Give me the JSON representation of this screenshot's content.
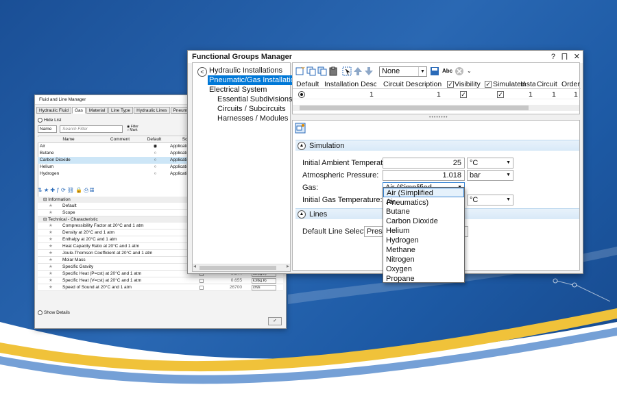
{
  "fluid_manager": {
    "title": "Fluid and Line Manager",
    "tabs": [
      "Hydraulic Fluid",
      "Gas",
      "Material",
      "Line Type",
      "Hydraulic Lines",
      "Pneumatic Lines"
    ],
    "hide_list": "Hide List",
    "name_combo": "Name",
    "search_placeholder": "Search Filter",
    "radio_filter": "Filter",
    "radio_mark": "Mark",
    "columns": [
      "Name",
      "Comment",
      "Default",
      "Scope"
    ],
    "rows": [
      {
        "name": "Air",
        "scope": "Application",
        "default": true
      },
      {
        "name": "Butane",
        "scope": "Application",
        "default": false
      },
      {
        "name": "Carbon Dioxide",
        "scope": "Application",
        "default": false
      },
      {
        "name": "Helium",
        "scope": "Application",
        "default": false
      },
      {
        "name": "Hydrogen",
        "scope": "Application",
        "default": false
      }
    ],
    "groups": [
      {
        "name": "Information",
        "items": [
          {
            "label": "Default",
            "value": "",
            "unit": ""
          },
          {
            "label": "Scope",
            "value": "",
            "unit": ""
          }
        ]
      },
      {
        "name": "Technical - Characteristic",
        "items": [
          {
            "label": "Compressibility Factor at 20°C and 1 atm",
            "value": "",
            "unit": ""
          },
          {
            "label": "Density at 20°C and 1 atm",
            "value": "",
            "unit": ""
          },
          {
            "label": "Enthalpy at 20°C and 1 atm",
            "value": "",
            "unit": ""
          },
          {
            "label": "Heat Capacity Ratio at 20°C and 1 atm",
            "value": "",
            "unit": ""
          },
          {
            "label": "Joule-Thomson Coefficient at 20°C and 1 atm",
            "value": "",
            "unit": ""
          },
          {
            "label": "Molar Mass",
            "value": "",
            "unit": ""
          },
          {
            "label": "Specific Gravity",
            "value": "",
            "unit": ""
          },
          {
            "label": "Specific Heat (P=cst) at 20°C and 1 atm",
            "value": "0.844",
            "unit": "kJ/(kg.K)"
          },
          {
            "label": "Specific Heat (V=cst) at 20°C and 1 atm",
            "value": "0.655",
            "unit": "kJ/(kg.K)"
          },
          {
            "label": "Speed of Sound at 20°C and 1 atm",
            "value": "26700",
            "unit": "cm/s"
          }
        ]
      }
    ],
    "show_details": "Show Details"
  },
  "groups_manager": {
    "title": "Functional Groups Manager",
    "window_buttons": [
      "?",
      "⨅",
      "✕"
    ],
    "tree": [
      {
        "label": "Hydraulic Installations",
        "level": 0,
        "selected": false
      },
      {
        "label": "Pneumatic/Gas Installations",
        "level": 0,
        "selected": true
      },
      {
        "label": "Electrical System",
        "level": 0,
        "selected": false
      },
      {
        "label": "Essential Subdivisions / Locat",
        "level": 1,
        "selected": false
      },
      {
        "label": "Circuits / Subcircuits",
        "level": 1,
        "selected": false
      },
      {
        "label": "Harnesses / Modules",
        "level": 1,
        "selected": false
      }
    ],
    "toolbar": {
      "filter_combo": "None",
      "abc": "Abc"
    },
    "columns": [
      "Default",
      "Installation Descripti",
      "Circuit Description",
      "Visibility",
      "Simulated",
      "Instal",
      "Circuit N",
      "Order"
    ],
    "row": {
      "installation": "1",
      "circuit": "1",
      "instal": "1",
      "circuit_n": "1",
      "order": "1"
    },
    "simulation": {
      "header": "Simulation",
      "ambient_label": "Initial Ambient Temperature:",
      "ambient_value": "25",
      "ambient_unit": "°C",
      "pressure_label": "Atmospheric Pressure:",
      "pressure_value": "1.018",
      "pressure_unit": "bar",
      "gas_label": "Gas:",
      "gas_value": "Air (Simplified Pneumatics)",
      "gas_temp_label": "Initial Gas Temperature:",
      "gas_temp_unit": "°C"
    },
    "lines": {
      "header": "Lines",
      "default_label": "Default Line Selection:",
      "default_value": "Pressu"
    },
    "gas_options": [
      "Air (Simplified Pneumatics)",
      "Air",
      "Butane",
      "Carbon Dioxide",
      "Helium",
      "Hydrogen",
      "Methane",
      "Nitrogen",
      "Oxygen",
      "Propane"
    ]
  },
  "colors": {
    "selection": "#0078d7",
    "section_bg": "#dceaf8",
    "background": "#1f5ba8",
    "accent_yellow": "#f4c22b"
  }
}
